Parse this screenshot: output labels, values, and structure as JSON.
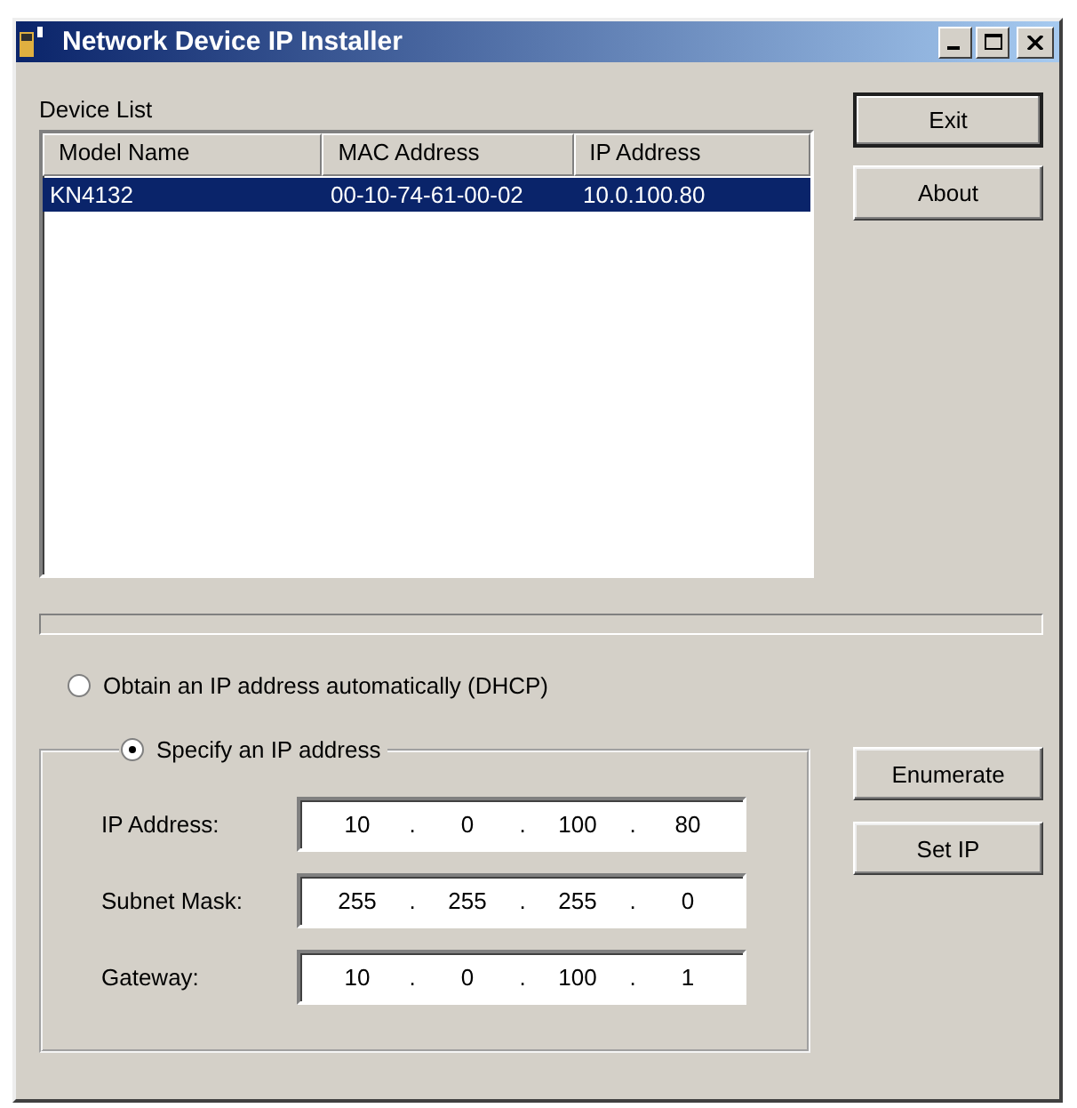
{
  "window": {
    "title": "Network Device IP Installer"
  },
  "device_list": {
    "label": "Device List",
    "columns": [
      "Model Name",
      "MAC Address",
      "IP Address"
    ],
    "rows": [
      {
        "cells": [
          "KN4132",
          "00-10-74-61-00-02",
          "10.0.100.80"
        ],
        "selected": true
      }
    ]
  },
  "top_buttons": [
    {
      "label": "Exit",
      "default": true
    },
    {
      "label": "About",
      "default": false
    }
  ],
  "progress": {
    "level": 0
  },
  "address_mode": [
    {
      "label": "Obtain an IP address automatically (DHCP)",
      "selected": false
    },
    {
      "label": "Specify an IP address",
      "selected": true
    }
  ],
  "ip_fields": [
    {
      "label": "IP Address:",
      "octets": [
        "10",
        "0",
        "100",
        "80"
      ],
      "dots": [
        ".",
        ".",
        "."
      ]
    },
    {
      "label": "Subnet Mask:",
      "octets": [
        "255",
        "255",
        "255",
        "0"
      ],
      "dots": [
        ".",
        ".",
        "."
      ]
    },
    {
      "label": "Gateway:",
      "octets": [
        "10",
        "0",
        "100",
        "1"
      ],
      "dots": [
        ".",
        ".",
        "."
      ]
    }
  ],
  "bottom_buttons": [
    {
      "label": "Enumerate",
      "default": false
    },
    {
      "label": "Set IP",
      "default": false
    }
  ]
}
